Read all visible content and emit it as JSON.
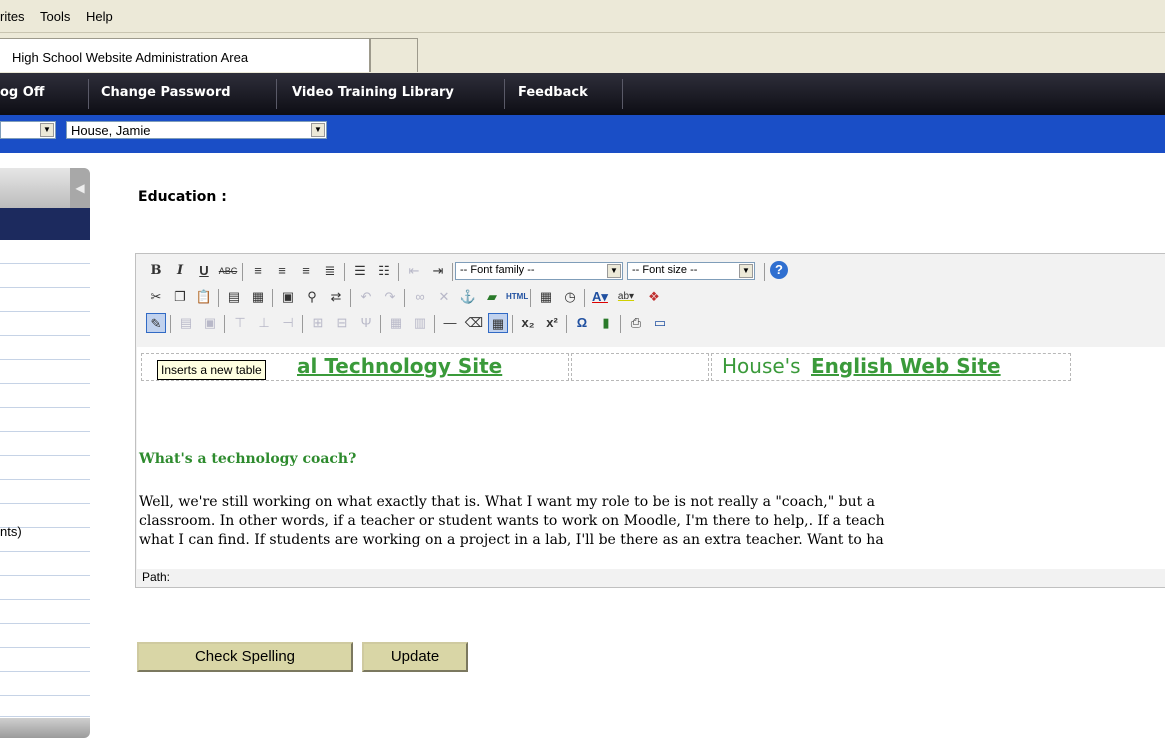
{
  "menubar": {
    "items": [
      "rites",
      "Tools",
      "Help"
    ]
  },
  "browser_tab": {
    "title": "High School Website Administration Area"
  },
  "nav": {
    "items": [
      "og Off",
      "Change Password",
      "Video Training Library",
      "Feedback"
    ]
  },
  "selector": {
    "teacher": "House, Jamie"
  },
  "sidebar": {
    "partial_text": "nts)"
  },
  "page": {
    "heading": "Education :"
  },
  "editor": {
    "font_family_placeholder": "-- Font family --",
    "font_size_placeholder": "-- Font size --",
    "tooltip": "Inserts a new table",
    "table_left_text": "al Technology Site",
    "table_right_prefix": "House's ",
    "table_right_link": "English Web Site",
    "question": "What's a technology coach?",
    "paragraph_lines": [
      "     Well, we're still working on what exactly that is.  What I want my role to be is not really a \"coach,\" but a",
      "classroom.  In other words, if a teacher or student wants to work on Moodle, I'm there to help,.  If a teach",
      "what I can find.  If students are working on a project in a lab, I'll be there as an extra teacher.  Want to ha"
    ],
    "path_label": "Path:"
  },
  "buttons": {
    "check_spelling": "Check Spelling",
    "update": "Update"
  },
  "toolbar": {
    "row1": [
      "bold-icon",
      "italic-icon",
      "underline-icon",
      "strikethrough-icon",
      "align-left-icon",
      "align-center-icon",
      "align-right-icon",
      "align-justify-icon",
      "bullet-list-icon",
      "numbered-list-icon",
      "outdent-icon",
      "indent-icon",
      "help-icon"
    ],
    "row2": [
      "cut-icon",
      "copy-icon",
      "paste-icon",
      "paste-text-icon",
      "paste-word-icon",
      "select-all-icon",
      "find-icon",
      "replace-icon",
      "undo-icon",
      "redo-icon",
      "link-icon",
      "unlink-icon",
      "anchor-icon",
      "image-icon",
      "html-icon",
      "insert-date-icon",
      "insert-time-icon",
      "text-color-icon",
      "highlight-color-icon",
      "color-palette-icon"
    ],
    "row3": [
      "insert-table-icon",
      "row-properties-icon",
      "cell-properties-icon",
      "insert-row-before-icon",
      "insert-row-after-icon",
      "insert-column-after-icon",
      "split-cells-icon",
      "merge-cells-icon",
      "delete-row-icon",
      "table-grid-icon",
      "table-grid2-icon",
      "horizontal-rule-icon",
      "eraser-icon",
      "visual-aid-icon",
      "subscript-icon",
      "superscript-icon",
      "special-char-icon",
      "media-icon",
      "print-icon",
      "fullscreen-icon"
    ]
  },
  "colors": {
    "nav_bg": "#151520",
    "blue_bar": "#1a4ec6",
    "link_green": "#3a9a3a",
    "button_bg": "#d9d6a6"
  }
}
